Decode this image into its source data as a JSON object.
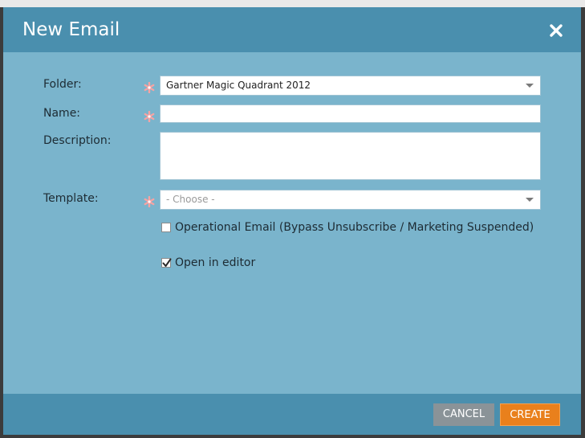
{
  "dialog": {
    "title": "New Email",
    "close_icon": "close-icon"
  },
  "form": {
    "folder": {
      "label": "Folder:",
      "required": true,
      "value": "Gartner Magic Quadrant 2012"
    },
    "name": {
      "label": "Name:",
      "required": true,
      "value": ""
    },
    "description": {
      "label": "Description:",
      "required": false,
      "value": ""
    },
    "template": {
      "label": "Template:",
      "required": true,
      "placeholder": "- Choose -"
    },
    "operational_email": {
      "label": "Operational Email (Bypass Unsubscribe / Marketing Suspended)",
      "checked": false
    },
    "open_in_editor": {
      "label": "Open in editor",
      "checked": true
    }
  },
  "footer": {
    "cancel_label": "CANCEL",
    "create_label": "CREATE"
  },
  "colors": {
    "header": "#4a8fae",
    "body": "#7ab4cc",
    "required_asterisk": "#f08a8a",
    "create_button": "#e9801c",
    "cancel_button": "#8a9398"
  }
}
